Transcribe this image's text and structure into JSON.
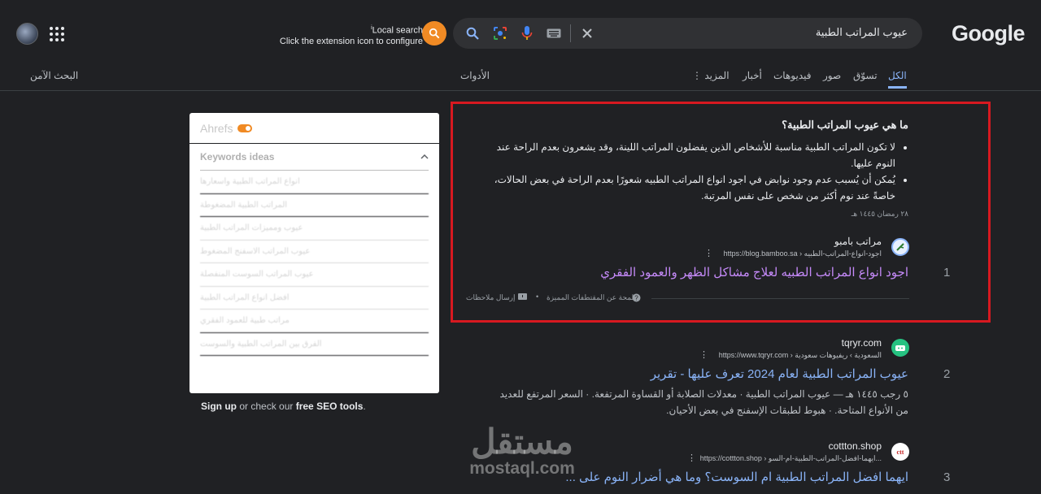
{
  "header": {
    "logo": "Google",
    "search_query": "عيوب المراتب الطبية",
    "extension_label_top": "Local search",
    "extension_label_sup": "i",
    "extension_label_bottom": "Click the extension icon to configure",
    "safe_search": "البحث الآمن"
  },
  "tabs": [
    {
      "label": "الكل",
      "active": true
    },
    {
      "label": "تسوّق"
    },
    {
      "label": "صور"
    },
    {
      "label": "فيديوهات"
    },
    {
      "label": "أخبار"
    },
    {
      "label": "المزيد"
    }
  ],
  "tools_label": "الأدوات",
  "featured": {
    "question": "ما هي عيوب المراتب الطبية؟",
    "bullet1": "لا تكون المراتب الطبية مناسبة للأشخاص الذين يفضلون المراتب اللينة، وقد يشعرون بعدم الراحة عند النوم عليها.",
    "bullet2": "يُمكن أن يُسبب عدم وجود نوابض في اجود انواع المراتب الطبيه شعورًا بعدم الراحة في بعض الحالات، خاصةً عند نوم أكثر من شخص على نفس المرتبة.",
    "date": "٢٨ رمضان ١٤٤٥ هـ",
    "site_name": "مراتب بامبو",
    "site_url": "https://blog.bamboo.sa › اجود-انواع-المراتب-الطبيه",
    "title": "اجود انواع المراتب الطبيه لعلاج مشاكل الظهر والعمود الفقري",
    "rank": "1",
    "about_label": "لمحة عن المقتطفات المميزة",
    "feedback_label": "إرسال ملاحظات"
  },
  "results": [
    {
      "rank": "2",
      "site_name": "tqryr.com",
      "site_url": "https://www.tqryr.com › السعودية › ريفيوهات سعودية",
      "title": "عيوب المراتب الطبية لعام 2024 تعرف عليها - تقرير",
      "desc": "٥ رجب ١٤٤٥ هـ — عيوب المراتب الطبية · معدلات الصلابة أو القساوة المرتفعة. · السعر المرتفع للعديد من الأنواع المتاحة. · هبوط لطبقات الإسفنج في بعض الأحيان."
    },
    {
      "rank": "3",
      "site_name": "cottton.shop",
      "site_url": "https://cottton.shop › ايهما-افضل-المراتب-الطبية-ام-السو...",
      "title": "ايهما افضل المراتب الطبية ام السوست؟ وما هي أضرار النوم على ..."
    }
  ],
  "ahrefs": {
    "brand": "Ahrefs",
    "section_title": "Keywords ideas",
    "items": [
      "انواع المراتب الطبية واسعارها",
      "المراتب الطبية المضغوطة",
      "عيوب ومميزات المراتب الطبية",
      "عيوب المراتب الاسفنج المضغوط",
      "عيوب المراتب السوست المنفصلة",
      "افضل انواع المراتب الطبية",
      "مراتب طبية للعمود الفقري",
      "الفرق بين المراتب الطبية والسوست"
    ],
    "signup_link": "Sign up",
    "signup_mid": "or check our",
    "signup_tools": "free SEO tools",
    "signup_end": "."
  },
  "watermark": {
    "arabic": "مستقل",
    "english": "mostaql.com"
  },
  "colors": {
    "background": "#202124",
    "link_visited": "#c58af9",
    "link": "#8ab4f8",
    "highlight_border": "#d71920",
    "accent_orange": "#f08a24"
  }
}
